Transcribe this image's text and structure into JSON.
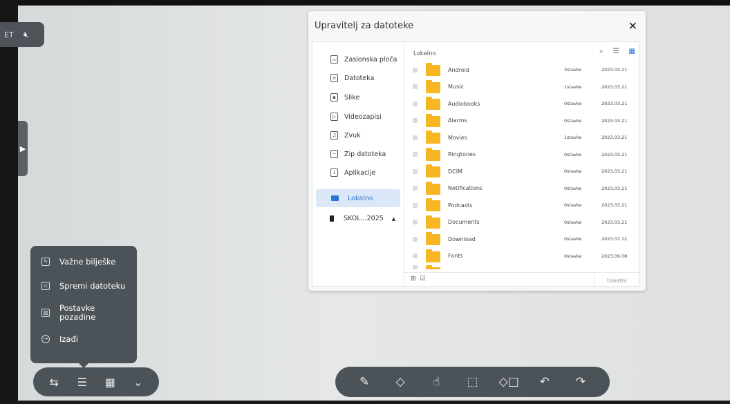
{
  "top_pill": {
    "partial_text": "ET",
    "mute_icon": "speaker-mute-icon"
  },
  "dialog": {
    "title": "Upravitelj za datoteke",
    "close_icon": "close-icon",
    "nav": [
      {
        "label": "Zaslonska ploča",
        "icon": "whiteboard-icon"
      },
      {
        "label": "Datoteka",
        "icon": "document-icon"
      },
      {
        "label": "Slike",
        "icon": "image-icon"
      },
      {
        "label": "Videozapisi",
        "icon": "video-icon"
      },
      {
        "label": "Zvuk",
        "icon": "music-icon"
      },
      {
        "label": "Zip datoteka",
        "icon": "zip-icon"
      },
      {
        "label": "Aplikacije",
        "icon": "download-icon"
      }
    ],
    "local": "Lokalno",
    "usb": {
      "label": "SKOL...2025",
      "caret": "▲"
    },
    "content_header": "Lokalno",
    "tools": {
      "search": "search-icon",
      "sort": "sort-icon",
      "grid": "grid-view-icon"
    },
    "rows": [
      {
        "name": "Android",
        "count": "3stavke",
        "date": "2023.03.21"
      },
      {
        "name": "Music",
        "count": "1stavke",
        "date": "2023.03.21"
      },
      {
        "name": "Audiobooks",
        "count": "0stavke",
        "date": "2023.03.21"
      },
      {
        "name": "Alarms",
        "count": "0stavke",
        "date": "2023.03.21"
      },
      {
        "name": "Movies",
        "count": "1stavke",
        "date": "2023.03.21"
      },
      {
        "name": "Ringtones",
        "count": "0stavke",
        "date": "2023.03.21"
      },
      {
        "name": "DCIM",
        "count": "0stavke",
        "date": "2023.03.21"
      },
      {
        "name": "Notifications",
        "count": "0stavke",
        "date": "2023.03.21"
      },
      {
        "name": "Podcasts",
        "count": "0stavke",
        "date": "2023.03.21"
      },
      {
        "name": "Documents",
        "count": "0stavke",
        "date": "2023.03.21"
      },
      {
        "name": "Download",
        "count": "0stavke",
        "date": "2023.07.12"
      },
      {
        "name": "Fonts",
        "count": "0stavke",
        "date": "2023.09.08"
      }
    ],
    "insert_label": "Umetni"
  },
  "menu": [
    {
      "label": "Važne bilješke",
      "icon": "notes-icon"
    },
    {
      "label": "Spremi datoteku",
      "icon": "save-icon"
    },
    {
      "label": "Postavke\npozadine",
      "icon": "background-icon"
    },
    {
      "label": "Izađi",
      "icon": "exit-icon"
    }
  ],
  "bottom_left_tools": [
    "swap-icon",
    "list-icon",
    "qr-code-icon",
    "chevron-down-icon"
  ],
  "bottom_right_tools": [
    "pen-icon",
    "eraser-icon",
    "hand-pointer-icon",
    "lasso-select-icon",
    "shapes-icon",
    "undo-icon",
    "redo-icon"
  ],
  "colors": {
    "accent": "#2b73d6",
    "folder": "#f6b722",
    "toolbar": "#4c5358"
  }
}
